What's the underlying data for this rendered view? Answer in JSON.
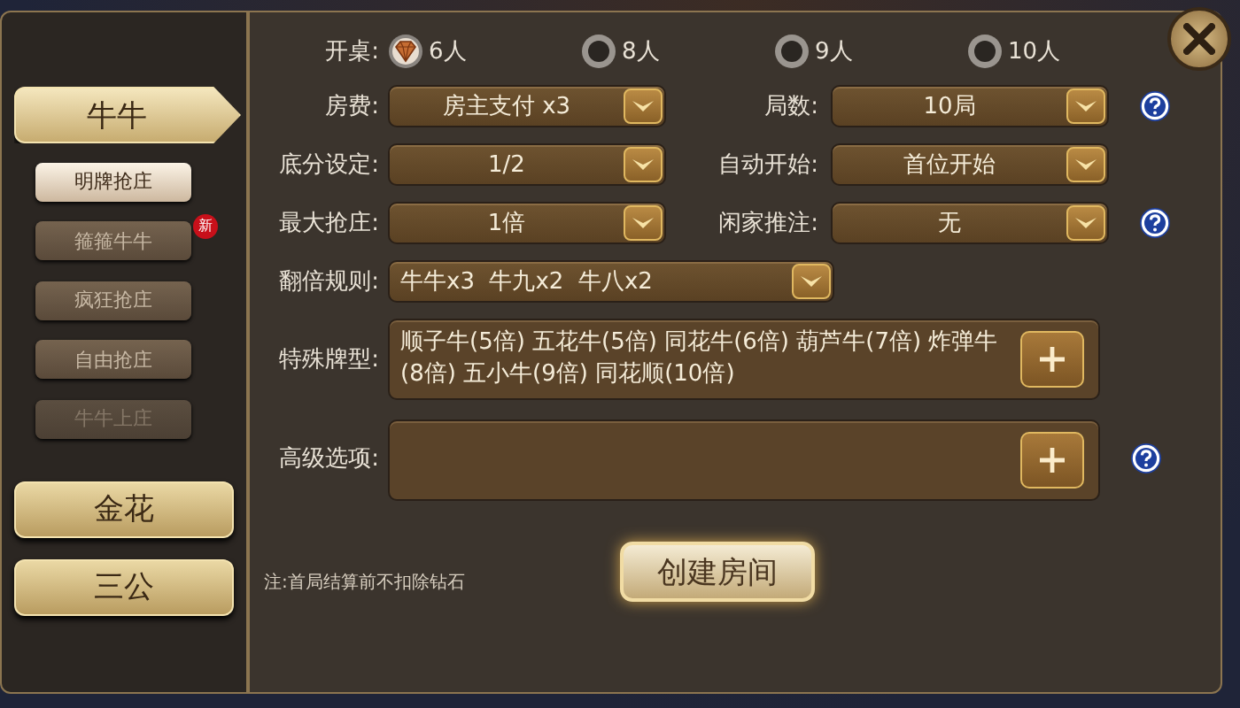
{
  "games": [
    {
      "label": "牛牛",
      "selected": true
    },
    {
      "label": "金花",
      "selected": false
    },
    {
      "label": "三公",
      "selected": false
    }
  ],
  "modes": [
    {
      "label": "明牌抢庄",
      "selected": true,
      "disabled": false
    },
    {
      "label": "箍箍牛牛",
      "selected": false,
      "disabled": false,
      "badge": "新"
    },
    {
      "label": "疯狂抢庄",
      "selected": false,
      "disabled": false
    },
    {
      "label": "自由抢庄",
      "selected": false,
      "disabled": false
    },
    {
      "label": "牛牛上庄",
      "selected": false,
      "disabled": true
    }
  ],
  "table_size": {
    "label": "开桌:",
    "options": [
      {
        "label": "6人",
        "selected": true
      },
      {
        "label": "8人",
        "selected": false
      },
      {
        "label": "9人",
        "selected": false
      },
      {
        "label": "10人",
        "selected": false
      }
    ]
  },
  "settings": [
    {
      "label": "房费:",
      "value": "房主支付 x3",
      "label2": "局数:",
      "value2": "10局",
      "help": true
    },
    {
      "label": "底分设定:",
      "value": "1/2",
      "label2": "自动开始:",
      "value2": "首位开始",
      "help": false
    },
    {
      "label": "最大抢庄:",
      "value": "1倍",
      "label2": "闲家推注:",
      "value2": "无",
      "help": true
    }
  ],
  "double_rule": {
    "label": "翻倍规则:",
    "value": "牛牛x3  牛九x2  牛八x2"
  },
  "special_hands": {
    "label": "特殊牌型:",
    "value": "顺子牛(5倍)  五花牛(5倍)  同花牛(6倍)  葫芦牛(7倍)  炸弹牛(8倍)  五小牛(9倍)  同花顺(10倍)",
    "help": false
  },
  "advanced": {
    "label": "高级选项:",
    "help": true
  },
  "note": "注:首局结算前不扣除钻石",
  "create_button": "创建房间"
}
